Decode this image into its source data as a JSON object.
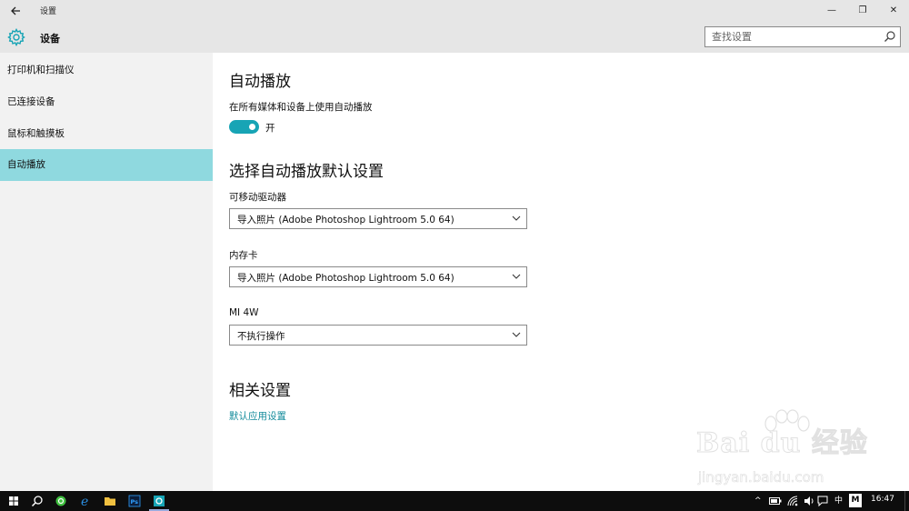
{
  "window": {
    "title": "设置",
    "back_icon": "back-arrow-icon",
    "minimize_glyph": "—",
    "maximize_glyph": "❐",
    "close_glyph": "✕"
  },
  "header": {
    "title": "设备",
    "icon": "gear-icon",
    "search_placeholder": "查找设置"
  },
  "sidebar": {
    "items": [
      {
        "label": "打印机和扫描仪",
        "active": false
      },
      {
        "label": "已连接设备",
        "active": false
      },
      {
        "label": "鼠标和触摸板",
        "active": false
      },
      {
        "label": "自动播放",
        "active": true
      }
    ]
  },
  "main": {
    "autoplay": {
      "heading": "自动播放",
      "toggle_label": "在所有媒体和设备上使用自动播放",
      "toggle_state": "开",
      "toggle_on": true
    },
    "defaults": {
      "heading": "选择自动播放默认设置",
      "dropdowns": [
        {
          "label": "可移动驱动器",
          "value": "导入照片 (Adobe Photoshop Lightroom 5.0 64)"
        },
        {
          "label": "内存卡",
          "value": "导入照片 (Adobe Photoshop Lightroom 5.0 64)"
        },
        {
          "label": "MI 4W",
          "value": "不执行操作"
        }
      ]
    },
    "related": {
      "heading": "相关设置",
      "link": "默认应用设置"
    }
  },
  "watermark": {
    "brand": "Bai du 经验",
    "url": "jingyan.baidu.com"
  },
  "taskbar": {
    "apps": [
      "windows-start-icon",
      "search-icon",
      "360-browser-icon",
      "internet-explorer-icon",
      "file-explorer-icon",
      "photoshop-icon",
      "settings-icon"
    ],
    "tray": {
      "chevron": "^",
      "ime_lang": "中",
      "ime_mode": "M",
      "time": "16:47"
    }
  },
  "colors": {
    "accent": "#17a4b5",
    "selected_nav": "#8fd9df",
    "link": "#138b9b",
    "chrome": "#e6e6e6",
    "sidebar": "#f2f2f2",
    "taskbar": "#0d0d0d"
  }
}
